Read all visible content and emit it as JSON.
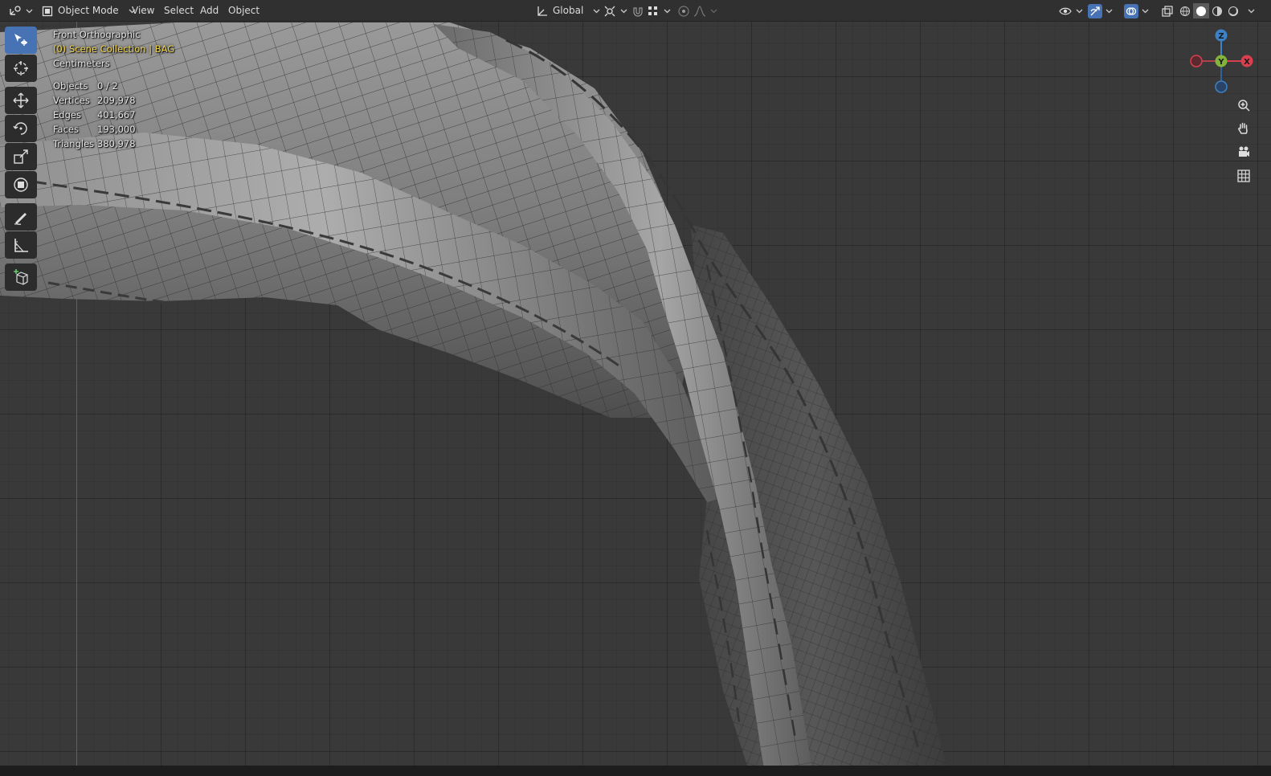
{
  "header": {
    "mode_label": "Object Mode",
    "menu": {
      "view": "View",
      "select": "Select",
      "add": "Add",
      "object": "Object"
    },
    "transform_orientation": "Global",
    "icons": {
      "editor_type": "editor-type-icon",
      "mode": "object-mode-icon",
      "orientation": "transform-orientation-icon",
      "pivot": "pivot-point-icon",
      "snap": "snap-magnet-icon",
      "snap_target": "snap-increment-icon",
      "proportional": "proportional-edit-icon",
      "falloff": "falloff-curve-icon",
      "visibility": "object-visibility-icon",
      "gizmos": "gizmo-toggle-icon",
      "overlays": "overlay-toggle-icon",
      "xray": "xray-toggle-icon",
      "shading_wire": "wireframe-shading-icon",
      "shading_solid": "solid-shading-icon",
      "shading_material": "material-shading-icon",
      "shading_rendered": "rendered-shading-icon"
    }
  },
  "toolbar": {
    "tools": [
      "select-box-icon",
      "cursor-icon",
      "move-icon",
      "rotate-icon",
      "scale-icon",
      "transform-icon",
      "annotate-icon",
      "measure-icon",
      "add-cube-icon"
    ],
    "active_tool": "select-box-icon"
  },
  "overlay": {
    "view_name": "Front Orthographic",
    "collection": "(0) Scene Collection | BAG",
    "units": "Centimeters",
    "stats": [
      {
        "label": "Objects",
        "value": "0 / 2"
      },
      {
        "label": "Vertices",
        "value": "209,978"
      },
      {
        "label": "Edges",
        "value": "401,667"
      },
      {
        "label": "Faces",
        "value": "193,000"
      },
      {
        "label": "Triangles",
        "value": "380,978"
      }
    ]
  },
  "gizmo": {
    "axis_labels": {
      "z": "Z",
      "y": "Y",
      "x": "X"
    },
    "colors": {
      "x": "#d8404f",
      "y": "#82b43b",
      "z": "#3b82c8"
    },
    "nav_buttons": [
      "zoom-icon",
      "pan-hand-icon",
      "camera-view-icon",
      "ortho-grid-icon"
    ]
  },
  "colors": {
    "accent": "#4772b3",
    "header_bg": "#303030",
    "viewport_bg": "#393939",
    "overlay_highlight": "#f4d84b"
  }
}
